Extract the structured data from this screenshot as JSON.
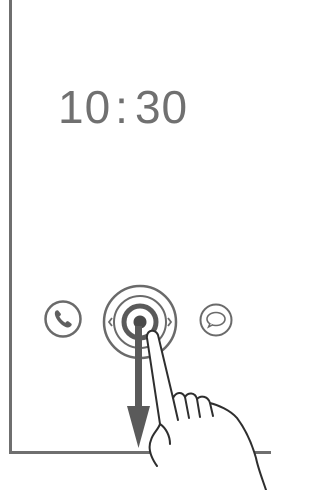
{
  "lock_screen": {
    "time_hours": "10",
    "time_separator": ":",
    "time_minutes": "30"
  },
  "icons": {
    "phone": "phone-icon",
    "unlock": "unlock-ring-icon",
    "message": "message-bubble-icon",
    "swipe_arrow": "arrow-down-icon",
    "hand": "hand-pointer-icon"
  },
  "colors": {
    "frame": "#6f6f6f",
    "clock_text": "#707070",
    "icon_stroke": "#6a6a6a",
    "arrow": "#5a5a5a"
  }
}
